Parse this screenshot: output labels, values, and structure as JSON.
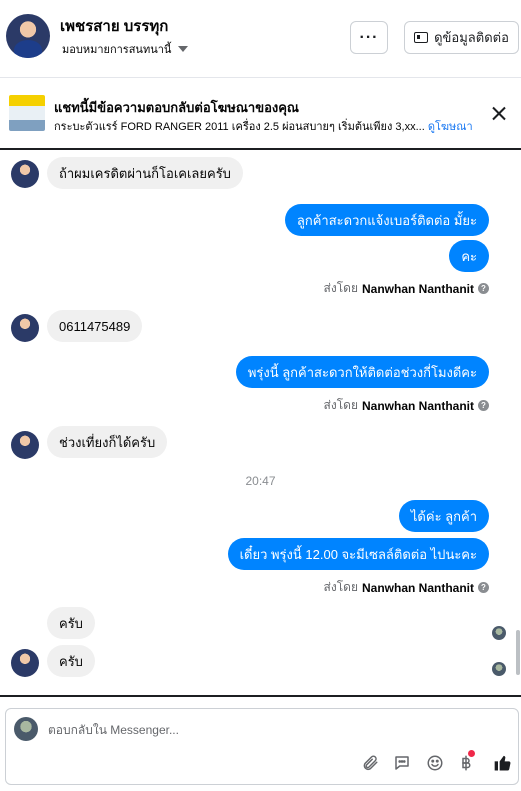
{
  "header": {
    "contact_name": "เพชรสาย บรรทุก",
    "assign_label": "มอบหมายการสนทนานี้",
    "more_label": "···",
    "contact_info_label": "ดูข้อมูลติดต่อ"
  },
  "ad_banner": {
    "title": "แชทนี้มีข้อความตอบกลับต่อโฆษณาของคุณ",
    "description": "กระบะตัวแรร์ FORD RANGER 2011 เครื่อง 2.5 ผ่อนสบายๆ เริ่มต้นเพียง 3,xx...",
    "link_label": "ดูโฆษณา"
  },
  "messages": {
    "m1": "ถ้าผมเครดิตผ่านก็โอเคเลยครับ",
    "m2": "ลูกค้าสะดวกแจ้งเบอร์ติดต่อ มั้ยะ",
    "m3": "คะ",
    "m4": "0611475489",
    "m5": "พรุ่งนี้ ลูกค้าสะดวกให้ติดต่อช่วงกี่โมงดีคะ",
    "m6": "ช่วงเที่ยงก็ได้ครับ",
    "m7": "ได้ค่ะ ลูกค้า",
    "m8": "เดี๋ยว พรุ่งนี้ 12.00 จะมีเซลล์ติดต่อ ไปนะคะ",
    "m9": "ครับ",
    "m10": "ครับ"
  },
  "sent_by": {
    "prefix": "ส่งโดย",
    "sender": "Nanwhan Nanthanit"
  },
  "timestamp": "20:47",
  "composer": {
    "placeholder": "ตอบกลับใน Messenger..."
  },
  "icons": {
    "attach": "paperclip-icon",
    "saved_reply": "chat-bubble-icon",
    "emoji": "smiley-icon",
    "payment": "baht-icon",
    "like": "thumbs-up-icon"
  },
  "colors": {
    "outgoing_bubble": "#0084ff",
    "incoming_bubble": "#f0f0f0",
    "link": "#1877f2",
    "notification_dot": "#f02849"
  }
}
